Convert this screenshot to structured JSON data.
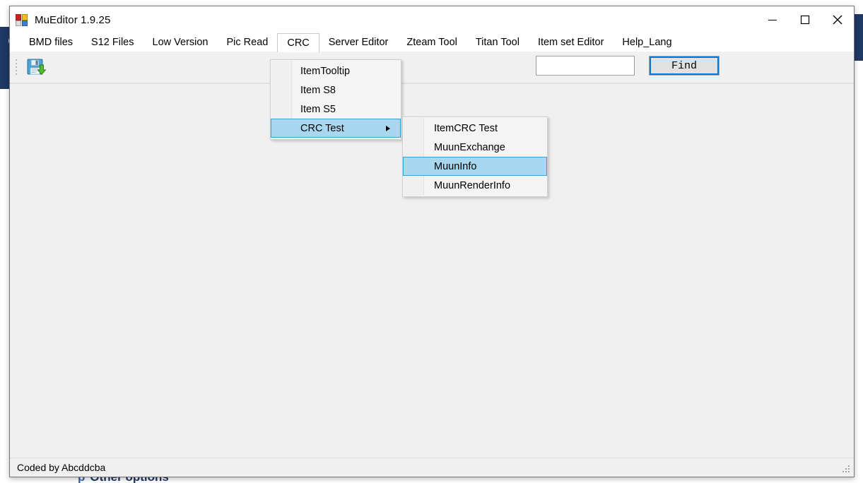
{
  "background": {
    "left_letter": "e",
    "bottom_text_prefix": "p",
    "bottom_text": "Other options",
    "panel_color": "#1f3864"
  },
  "window": {
    "title": "MuEditor 1.9.25",
    "icon": "app-squares-icon",
    "controls": {
      "minimize": "minimize-icon",
      "maximize": "maximize-icon",
      "close": "close-icon"
    }
  },
  "menubar": {
    "items": [
      {
        "label": "BMD files",
        "open": false
      },
      {
        "label": "S12 Files",
        "open": false
      },
      {
        "label": "Low Version",
        "open": false
      },
      {
        "label": "Pic Read",
        "open": false
      },
      {
        "label": "CRC",
        "open": true
      },
      {
        "label": "Server Editor",
        "open": false
      },
      {
        "label": "Zteam Tool",
        "open": false
      },
      {
        "label": "Titan Tool",
        "open": false
      },
      {
        "label": "Item set Editor",
        "open": false
      },
      {
        "label": "Help_Lang",
        "open": false
      }
    ]
  },
  "toolbar": {
    "save_icon": "save-floppy-icon",
    "grip": "toolstrip-grip",
    "search_value": "",
    "search_placeholder": "",
    "find_label": "Find"
  },
  "crc_menu": {
    "items": [
      {
        "label": "ItemTooltip",
        "highlighted": false,
        "has_submenu": false
      },
      {
        "label": "Item S8",
        "highlighted": false,
        "has_submenu": false
      },
      {
        "label": "Item S5",
        "highlighted": false,
        "has_submenu": false
      },
      {
        "label": "CRC Test",
        "highlighted": true,
        "has_submenu": true
      }
    ]
  },
  "crc_submenu": {
    "items": [
      {
        "label": "ItemCRC Test",
        "highlighted": false
      },
      {
        "label": "MuunExchange",
        "highlighted": false
      },
      {
        "label": "MuunInfo",
        "highlighted": true
      },
      {
        "label": "MuunRenderInfo",
        "highlighted": false
      }
    ]
  },
  "statusbar": {
    "text": "Coded by Abcddcba",
    "grip": "resize-grip"
  },
  "colors": {
    "highlight": "#a8d8f0",
    "highlight_border": "#3c9fd5",
    "focus_outline": "#0078d7",
    "window_chrome": "#f0f0f0",
    "background_panel": "#1f3864"
  }
}
